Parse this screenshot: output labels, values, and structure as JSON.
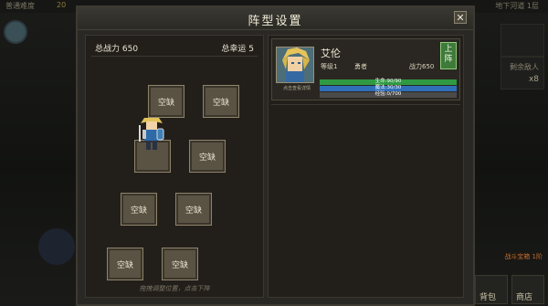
{
  "background": {
    "top_left_label": "普通难度",
    "top_coin": "20",
    "top_right_label": "地下河道 1层",
    "side_label": "剩余敌人",
    "side_count": "x8",
    "bottom_labels": [
      "背包",
      "商店"
    ],
    "bottom_left_label": "战斗宝箱 1阶"
  },
  "dialog": {
    "title": "阵型设置",
    "close_glyph": "✕"
  },
  "formation": {
    "total_power_label": "总战力 650",
    "total_luck_label": "总幸运 5",
    "slots": [
      {
        "label": "空缺"
      },
      {
        "label": "空缺"
      },
      {
        "label": ""
      },
      {
        "label": "空缺"
      },
      {
        "label": "空缺"
      },
      {
        "label": "空缺"
      },
      {
        "label": "空缺"
      },
      {
        "label": "空缺"
      }
    ],
    "hint": "拖拽调整位置，点击下阵"
  },
  "hero": {
    "name": "艾伦",
    "level": "等级1",
    "class": "勇者",
    "power": "战力650",
    "portrait_caption": "点击查看详情",
    "deploy_label": "上阵",
    "hp_text": "生命:90/90",
    "mp_text": "魔法:30/30",
    "exp_text": "经验:0/700",
    "hp_fraction": 1.0,
    "mp_fraction": 1.0,
    "exp_fraction": 0.0
  },
  "colors": {
    "hp": "#2f9a43",
    "mp": "#2f6fb8",
    "exp": "#5a5a5a",
    "deploy": "#3e7a3a"
  }
}
